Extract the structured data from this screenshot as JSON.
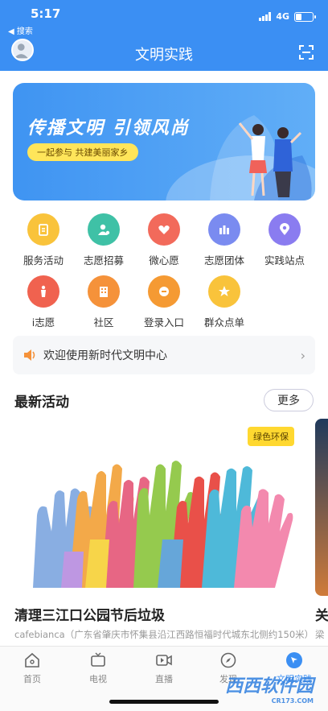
{
  "status": {
    "time": "5:17",
    "back": "◀ 搜索",
    "network": "4G",
    "battery_level": 0.35
  },
  "header": {
    "title": "文明实践"
  },
  "banner": {
    "title": "传播文明 引领风尚",
    "subtitle": "一起参与 共建美丽家乡"
  },
  "grid": [
    {
      "label": "服务活动",
      "color": "#f9c33b",
      "icon": "clipboard-icon"
    },
    {
      "label": "志愿招募",
      "color": "#3fc1a6",
      "icon": "recruit-icon"
    },
    {
      "label": "微心愿",
      "color": "#f26a5b",
      "icon": "heart-icon"
    },
    {
      "label": "志愿团体",
      "color": "#7a8bf0",
      "icon": "group-icon"
    },
    {
      "label": "实践站点",
      "color": "#8a7cf0",
      "icon": "location-icon"
    },
    {
      "label": "i志愿",
      "color": "#f0624f",
      "icon": "volunteer-icon"
    },
    {
      "label": "社区",
      "color": "#f5923a",
      "icon": "building-icon"
    },
    {
      "label": "登录入口",
      "color": "#f59a33",
      "icon": "login-icon"
    },
    {
      "label": "群众点单",
      "color": "#f9c33b",
      "icon": "star-icon"
    }
  ],
  "notice": {
    "text": "欢迎使用新时代文明中心"
  },
  "section": {
    "title": "最新活动",
    "more": "更多"
  },
  "activity": {
    "tag": "绿色环保",
    "title": "清理三江口公园节后垃圾",
    "address": "cafebianca（广东省肇庆市怀集县沿江西路恒福时代城东北侧约150米）"
  },
  "activity2": {
    "title": "关",
    "address": "梁"
  },
  "tabs": [
    {
      "label": "首页",
      "icon": "home-icon"
    },
    {
      "label": "电视",
      "icon": "tv-icon"
    },
    {
      "label": "直播",
      "icon": "live-icon"
    },
    {
      "label": "发现",
      "icon": "compass-icon"
    },
    {
      "label": "文明实践",
      "icon": "practice-icon"
    }
  ],
  "watermark": {
    "main": "西西软件园",
    "sub": "CR173.COM"
  }
}
